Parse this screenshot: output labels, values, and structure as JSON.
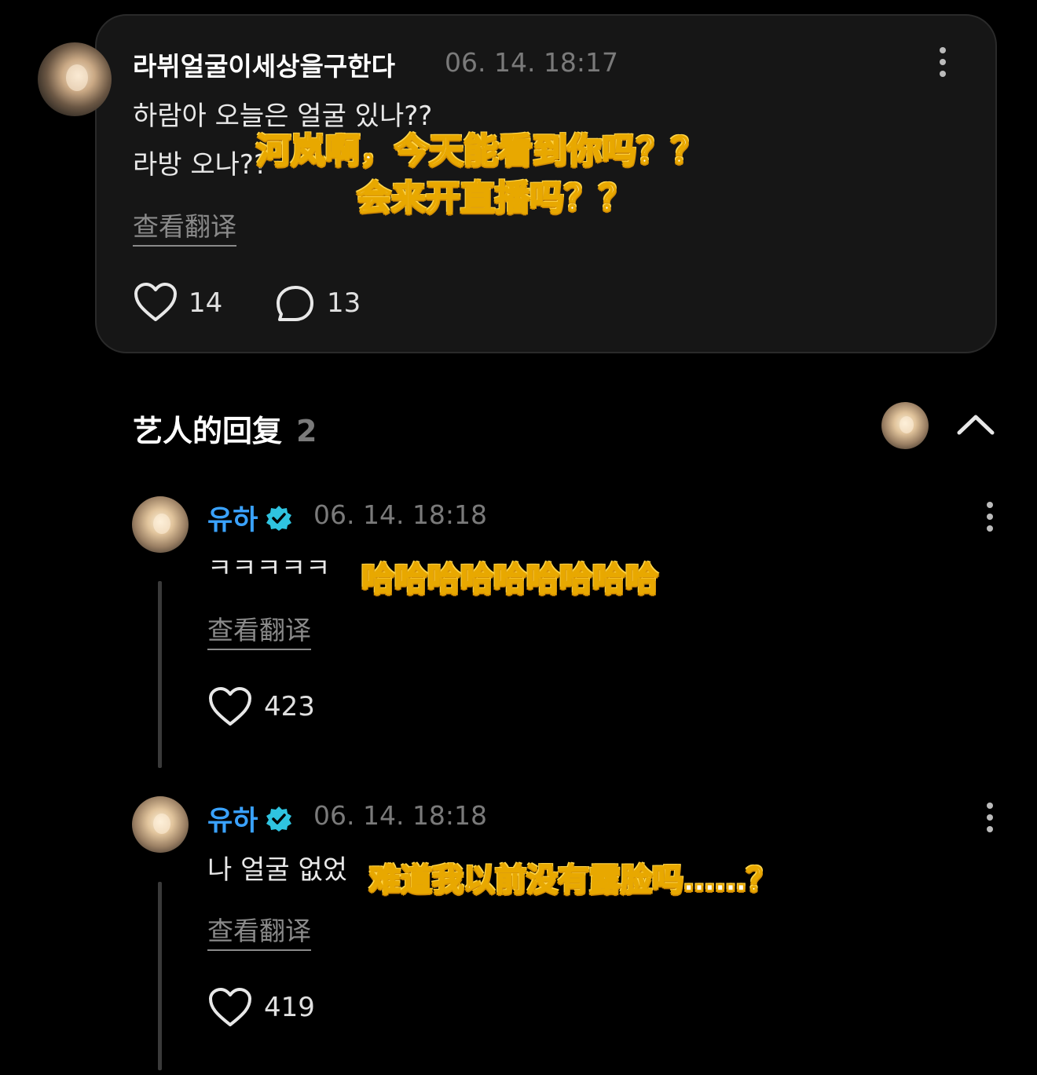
{
  "comment": {
    "username": "라뷔얼굴이세상을구한다",
    "timestamp": "06. 14. 18:17",
    "line1": "하람아 오늘은 얼굴 있나??",
    "line2": "라방 오나??",
    "translate_label": "查看翻译",
    "likes": "14",
    "replies": "13",
    "subtitle_line1": "河岚啊，今天能看到你吗？？",
    "subtitle_line2": "会来开直播吗？？"
  },
  "artist_section": {
    "title": "艺人的回复",
    "count": "2"
  },
  "replies": [
    {
      "name": "유하",
      "timestamp": "06. 14. 18:18",
      "text": "ㅋㅋㅋㅋㅋ",
      "subtitle": "哈哈哈哈哈哈哈哈哈",
      "translate_label": "查看翻译",
      "likes": "423"
    },
    {
      "name": "유하",
      "timestamp": "06. 14. 18:18",
      "text": "나 얼굴 없었",
      "subtitle": "难道我以前没有露脸吗……？",
      "translate_label": "查看翻译",
      "likes": "419"
    }
  ],
  "colors": {
    "background": "#000000",
    "card": "#161616",
    "artist_name": "#3aa2ff",
    "verified_badge": "#2fc3e0",
    "subtitle_outline": "#e8a800"
  },
  "icons": {
    "more": "more-vertical-icon",
    "like": "heart-outline-icon",
    "reply": "speech-bubble-icon",
    "verified": "verified-badge-icon",
    "collapse": "chevron-up-icon"
  }
}
